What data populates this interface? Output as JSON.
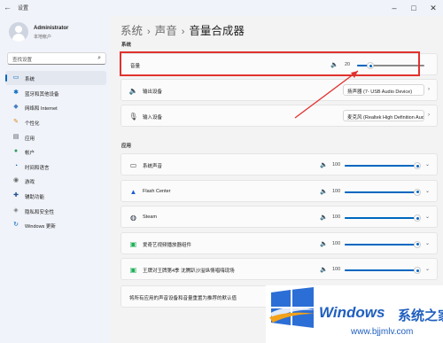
{
  "window": {
    "title": "设置",
    "back_icon": "back-arrow-icon",
    "controls": [
      "minimize-icon",
      "maximize-icon",
      "close-icon"
    ]
  },
  "user": {
    "name": "Administrator",
    "type": "本地帐户"
  },
  "search": {
    "placeholder": "查找设置"
  },
  "sidebar": {
    "items": [
      {
        "label": "系统",
        "icon": "system-icon",
        "glyph": "▭",
        "color": "#0067c0",
        "active": true
      },
      {
        "label": "蓝牙和其他设备",
        "icon": "bluetooth-icon",
        "glyph": "✱",
        "color": "#0067c0"
      },
      {
        "label": "网络和 Internet",
        "icon": "wifi-icon",
        "glyph": "◆",
        "color": "#4a7fc1"
      },
      {
        "label": "个性化",
        "icon": "brush-icon",
        "glyph": "✎",
        "color": "#d68a1a"
      },
      {
        "label": "应用",
        "icon": "apps-icon",
        "glyph": "▤",
        "color": "#556"
      },
      {
        "label": "帐户",
        "icon": "account-icon",
        "glyph": "●",
        "color": "#2e9a5a"
      },
      {
        "label": "时间和语言",
        "icon": "clock-icon",
        "glyph": "◔",
        "color": "#0067c0"
      },
      {
        "label": "游戏",
        "icon": "gamepad-icon",
        "glyph": "◉",
        "color": "#666"
      },
      {
        "label": "辅助功能",
        "icon": "accessibility-icon",
        "glyph": "✚",
        "color": "#1a4f8f"
      },
      {
        "label": "隐私和安全性",
        "icon": "shield-icon",
        "glyph": "◈",
        "color": "#777"
      },
      {
        "label": "Windows 更新",
        "icon": "update-icon",
        "glyph": "↻",
        "color": "#0067c0"
      }
    ]
  },
  "breadcrumb": {
    "crumbs": [
      "系统",
      "声音",
      "音量合成器"
    ]
  },
  "system_section": {
    "title": "系统",
    "volume": {
      "label": "音量",
      "value_text": "20",
      "level": 0.2
    },
    "output": {
      "label": "输出设备",
      "value": "扬声器 (7- USB Audio Device)"
    },
    "input": {
      "label": "输入设备",
      "value": "麦克风 (Realtek High Definition Audio)"
    }
  },
  "apps_section": {
    "title": "应用",
    "apps": [
      {
        "label": "系统声音",
        "icon": "system-sounds-icon",
        "glyph": "▭",
        "value_text": "100",
        "level": 1.0
      },
      {
        "label": "Flash Center",
        "icon": "flash-center-icon",
        "glyph": "▲",
        "value_text": "100",
        "level": 1.0
      },
      {
        "label": "Steam",
        "icon": "steam-icon",
        "glyph": "◍",
        "value_text": "100",
        "level": 1.0
      },
      {
        "label": "爱奇艺视频播放器组件",
        "icon": "iqiyi-icon",
        "glyph": "▣",
        "value_text": "100",
        "level": 1.0
      },
      {
        "label": "王牌对王牌第4季 沈腾趴沙溢纵情唱嗨现场",
        "icon": "iqiyi-video-icon",
        "glyph": "▣",
        "value_text": "100",
        "level": 1.0
      }
    ]
  },
  "reset": {
    "label": "将所有应用的声音设备和音量重置为推荐的默认值",
    "button": "重置"
  },
  "watermark": {
    "brand": "Windows",
    "brand_cn": "系统之家",
    "url": "www.bjjmlv.com"
  },
  "colors": {
    "accent": "#0067c0",
    "highlight": "#e0322e",
    "watermark": "#1f5fbf"
  }
}
